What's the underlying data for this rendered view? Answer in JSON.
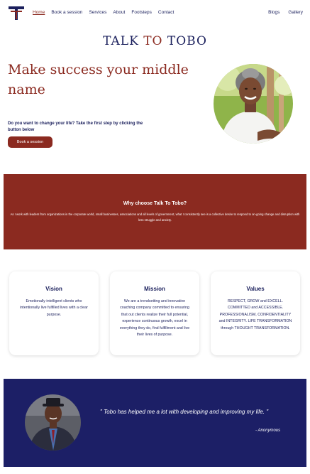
{
  "nav": {
    "links": [
      "Home",
      "Book a session",
      "Services",
      "About",
      "Footsteps",
      "Contact"
    ],
    "right_links": [
      "Blogs",
      "Gallery"
    ],
    "active": "Home"
  },
  "brand": {
    "part1": "TALK ",
    "part2": "TO",
    "part3": " TOBO"
  },
  "hero": {
    "title": "Make success your middle name",
    "text": "Do you want to change your life? Take the first step by clicking the button below",
    "button": "Book a session"
  },
  "why": {
    "title": "Why choose Talk To Tobo?",
    "text": "As I work with leaders from organizations in the corporate world, small businesses, associations and all levels of government, what I consistently see is a collective desire to respond to on-going change and disruption with less struggle and anxiety."
  },
  "cards": [
    {
      "title": "Vision",
      "text": "Emotionally intelligent clients who intentionally live fulfilled lives with a clear purpose."
    },
    {
      "title": "Mission",
      "text": "We are a trendsetting and innovative coaching company committed to ensuring that out clients realize their full potential, experience continuous growth, excel in everything they do, find fulfillment and live their lives of purpose."
    },
    {
      "title": "Values",
      "text": "RESPECT, GROW and EXCELL. COMMITTED and ACCESSIBLE. PROFESSIONALISM, CONFIDENTIALITY and INTEGRITY. LIFE TRANSFORMATION through THOUGHT TRANSFORMATION."
    }
  ],
  "testimonial": {
    "quote": "\" Tobo has helped me a lot with developing and improving my life. \"",
    "author": "- Anonymous"
  },
  "colors": {
    "navy": "#1a1f5c",
    "maroon": "#8b2a20",
    "band_navy": "#1c1f66"
  }
}
